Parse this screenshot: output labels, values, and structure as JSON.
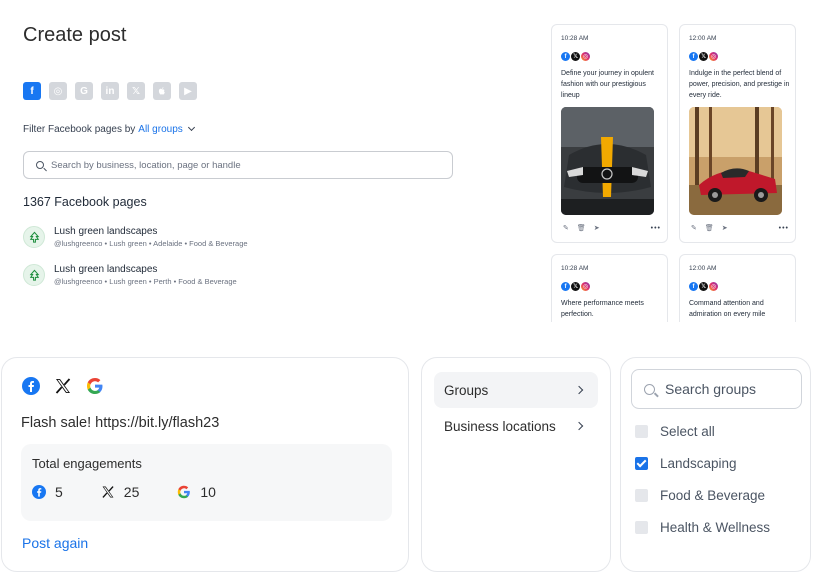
{
  "create_post": {
    "title": "Create post",
    "networks": [
      {
        "name": "facebook",
        "glyph": "f",
        "active": true
      },
      {
        "name": "instagram",
        "glyph": "◎",
        "active": false
      },
      {
        "name": "google",
        "glyph": "G",
        "active": false
      },
      {
        "name": "linkedin",
        "glyph": "in",
        "active": false
      },
      {
        "name": "x",
        "glyph": "𝕏",
        "active": false
      },
      {
        "name": "apple",
        "glyph": "",
        "active": false
      },
      {
        "name": "youtube",
        "glyph": "▶",
        "active": false
      }
    ],
    "filter_label": "Filter Facebook pages by",
    "filter_value": "All groups",
    "search_placeholder": "Search by business, location, page or handle",
    "count_label": "1367 Facebook pages",
    "pages": [
      {
        "name": "Lush green landscapes",
        "meta": "@lushgreenco • Lush green • Adelaide • Food & Beverage"
      },
      {
        "name": "Lush green landscapes",
        "meta": "@lushgreenco • Lush green • Perth • Food & Beverage"
      }
    ]
  },
  "previews": [
    {
      "time": "10:28 AM",
      "caption": "Define your journey in opulent fashion with our prestigious lineup"
    },
    {
      "time": "12:00 AM",
      "caption": "Indulge in the perfect blend of power, precision, and prestige in every ride."
    },
    {
      "time": "10:28 AM",
      "caption": "Where performance meets perfection."
    },
    {
      "time": "12:00 AM",
      "caption": "Command attention and admiration on every mile"
    }
  ],
  "stats_card": {
    "message": "Flash sale! https://bit.ly/flash23",
    "engagements_title": "Total engagements",
    "engagements": [
      {
        "network": "facebook",
        "value": "5"
      },
      {
        "network": "x",
        "value": "25"
      },
      {
        "network": "google",
        "value": "10"
      }
    ],
    "action_label": "Post again"
  },
  "filter_menu": {
    "items": [
      {
        "label": "Groups",
        "selected": true
      },
      {
        "label": "Business locations",
        "selected": false
      }
    ]
  },
  "groups_panel": {
    "search_placeholder": "Search groups",
    "options": [
      {
        "label": "Select all",
        "checked": false
      },
      {
        "label": "Landscaping",
        "checked": true
      },
      {
        "label": "Food & Beverage",
        "checked": false
      },
      {
        "label": "Health & Wellness",
        "checked": false
      }
    ]
  },
  "colors": {
    "accent": "#1a73e8",
    "facebook": "#1877f2"
  }
}
